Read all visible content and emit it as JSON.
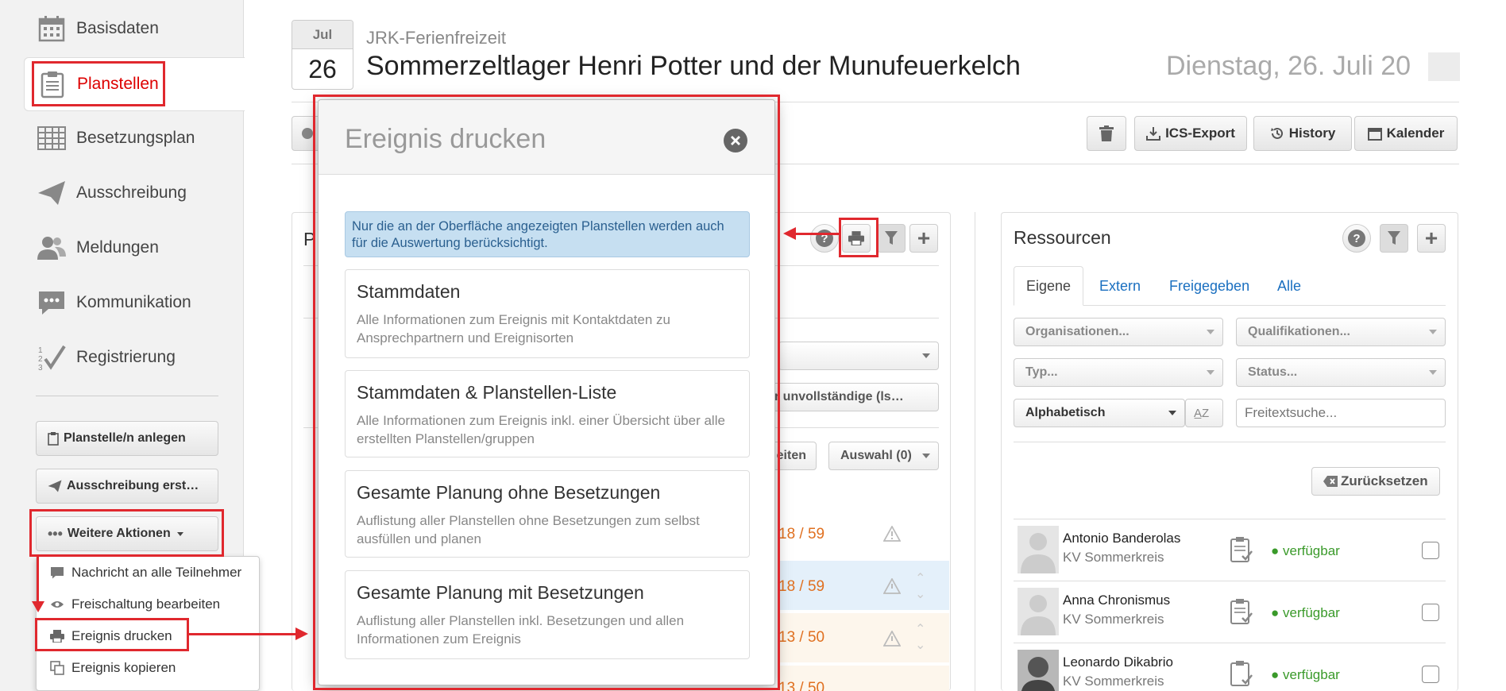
{
  "sidebar": {
    "items": [
      {
        "label": "Basisdaten",
        "icon": "calendar-icon"
      },
      {
        "label": "Planstellen",
        "icon": "clipboard-icon"
      },
      {
        "label": "Besetzungsplan",
        "icon": "grid-icon"
      },
      {
        "label": "Ausschreibung",
        "icon": "paper-plane-icon"
      },
      {
        "label": "Meldungen",
        "icon": "users-icon"
      },
      {
        "label": "Kommunikation",
        "icon": "chat-icon"
      },
      {
        "label": "Registrierung",
        "icon": "checklist-icon"
      }
    ],
    "buttons": {
      "create": "Planstelle/n anlegen",
      "tender": "Ausschreibung erst…",
      "more": "Weitere Aktionen"
    },
    "menu": [
      {
        "label": "Nachricht an alle Teilnehmer",
        "icon": "chat-icon"
      },
      {
        "label": "Freischaltung bearbeiten",
        "icon": "eye-icon"
      },
      {
        "label": "Ereignis drucken",
        "icon": "printer-icon"
      },
      {
        "label": "Ereignis kopieren",
        "icon": "copy-icon"
      }
    ]
  },
  "header": {
    "month": "Jul",
    "day": "26",
    "subtitle": "JRK-Ferienfreizeit",
    "title": "Sommerzeltlager Henri Potter und der Munufeuerkelch",
    "date": "Dienstag, 26. Juli 20"
  },
  "toolbar": {
    "ics": "ICS-Export",
    "history": "History",
    "calendar": "Kalender"
  },
  "planstellen_panel": {
    "title_initial": "P",
    "filter_tail": "r unvollständige (ls…",
    "edit_tail": "eiten",
    "selection": "Auswahl (0)",
    "rows": [
      {
        "count": "18 / 59"
      },
      {
        "count": "18 / 59"
      },
      {
        "count": "13 / 50"
      },
      {
        "count": "13 / 50"
      }
    ]
  },
  "resources": {
    "title": "Ressourcen",
    "tabs": [
      "Eigene",
      "Extern",
      "Freigegeben",
      "Alle"
    ],
    "filters": {
      "org": "Organisationen...",
      "qual": "Qualifikationen...",
      "type": "Typ...",
      "status": "Status...",
      "sort": "Alphabetisch",
      "search_placeholder": "Freitextsuche..."
    },
    "reset": "Zurücksetzen",
    "people": [
      {
        "name": "Antonio Banderolas",
        "org": "KV Sommerkreis",
        "status": "verfügbar"
      },
      {
        "name": "Anna Chronismus",
        "org": "KV Sommerkreis",
        "status": "verfügbar"
      },
      {
        "name": "Leonardo Dikabrio",
        "org": "KV Sommerkreis",
        "status": "verfügbar"
      }
    ]
  },
  "modal": {
    "title": "Ereignis drucken",
    "info": "Nur die an der Oberfläche angezeigten Planstellen werden auch für die Auswertung berücksichtigt.",
    "options": [
      {
        "title": "Stammdaten",
        "desc": "Alle Informationen zum Ereignis mit Kontaktdaten zu Ansprechpartnern und Ereignisorten"
      },
      {
        "title": "Stammdaten & Planstellen-Liste",
        "desc": "Alle Informationen zum Ereignis inkl. einer Übersicht über alle erstellten Planstellen/gruppen"
      },
      {
        "title": "Gesamte Planung ohne Besetzungen",
        "desc": "Auflistung aller Planstellen ohne Besetzungen zum selbst ausfüllen und planen"
      },
      {
        "title": "Gesamte Planung mit Besetzungen",
        "desc": "Auflistung aller Planstellen inkl. Besetzungen und allen Informationen zum Ereignis"
      }
    ]
  },
  "colors": {
    "accent_red": "#e0282e",
    "link_blue": "#1a6fc0",
    "available_green": "#3a9a2a",
    "count_orange": "#e07020"
  }
}
